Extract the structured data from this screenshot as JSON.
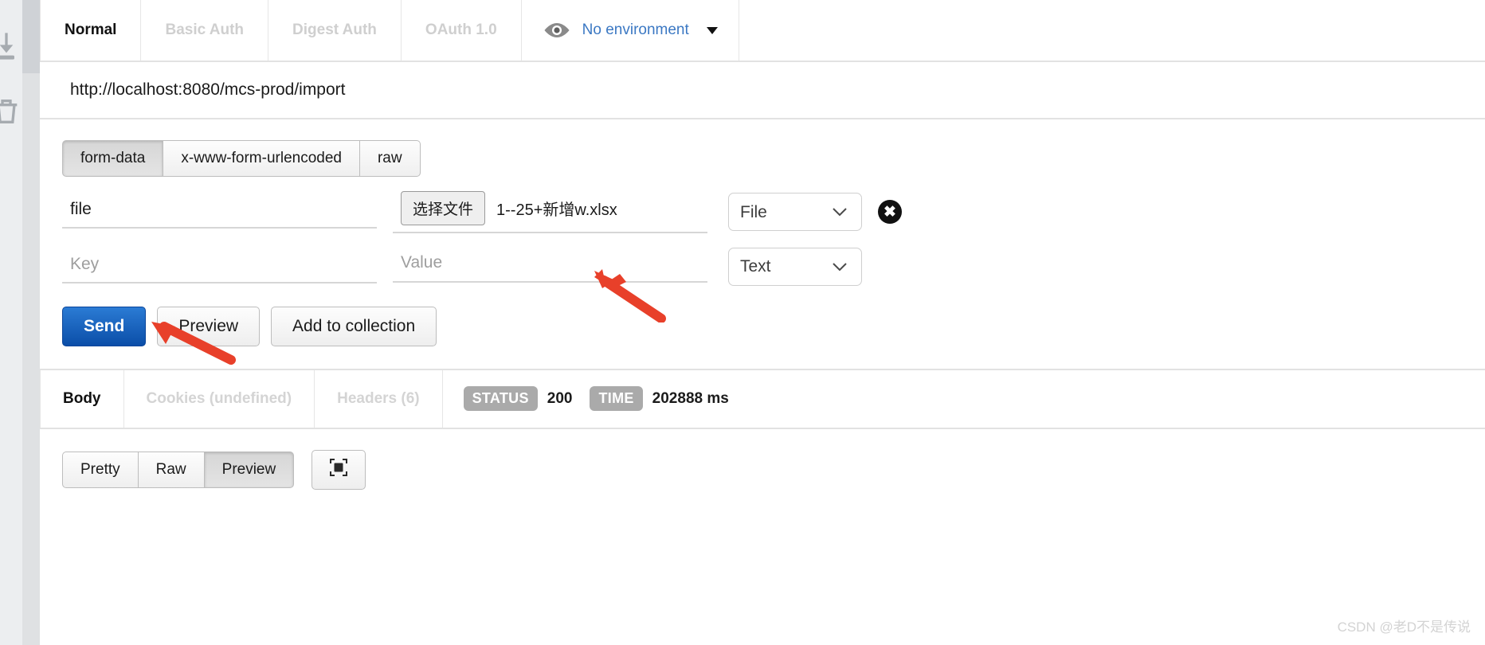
{
  "rail": {
    "icons": [
      "download-icon",
      "trash-icon"
    ]
  },
  "auth_tabs": [
    {
      "label": "Normal",
      "active": true
    },
    {
      "label": "Basic Auth",
      "active": false
    },
    {
      "label": "Digest Auth",
      "active": false
    },
    {
      "label": "OAuth 1.0",
      "active": false
    }
  ],
  "environment": {
    "icon": "eye-icon",
    "label": "No environment",
    "caret": "chevron-down-icon"
  },
  "url": {
    "value": "http://localhost:8080/mcs-prod/import"
  },
  "body_type_tabs": [
    {
      "label": "form-data",
      "active": true
    },
    {
      "label": "x-www-form-urlencoded",
      "active": false
    },
    {
      "label": "raw",
      "active": false
    }
  ],
  "form_rows": [
    {
      "key_value": "file",
      "key_placeholder": "Key",
      "value_kind": "file",
      "choose_file_label": "选择文件",
      "file_name": "1--25+新增w.xlsx",
      "type": "File",
      "has_delete": true,
      "delete_icon": "close-circle-icon"
    },
    {
      "key_value": "",
      "key_placeholder": "Key",
      "value_kind": "text",
      "value_placeholder": "Value",
      "value_text": "",
      "type": "Text",
      "has_delete": false
    }
  ],
  "type_options": [
    "Text",
    "File"
  ],
  "actions": {
    "send": "Send",
    "preview": "Preview",
    "add_to_collection": "Add to collection"
  },
  "response_tabs": [
    {
      "label": "Body",
      "active": true
    },
    {
      "label": "Cookies (undefined)",
      "active": false
    },
    {
      "label": "Headers (6)",
      "active": false
    }
  ],
  "response_meta": {
    "status_badge": "STATUS",
    "status_value": "200",
    "time_badge": "TIME",
    "time_value": "202888 ms"
  },
  "view_tabs": [
    {
      "label": "Pretty",
      "active": false
    },
    {
      "label": "Raw",
      "active": false
    },
    {
      "label": "Preview",
      "active": true
    }
  ],
  "expand_button": {
    "icon": "expand-icon"
  },
  "colors": {
    "accent_blue": "#0b4ea8",
    "link_blue": "#3b78c3",
    "badge_gray": "#aaaaaa",
    "arrow_red": "#e8402a"
  },
  "annotations": [
    {
      "name": "arrow-to-value-field"
    },
    {
      "name": "arrow-to-send-button"
    }
  ],
  "watermark": "CSDN @老D不是传说"
}
